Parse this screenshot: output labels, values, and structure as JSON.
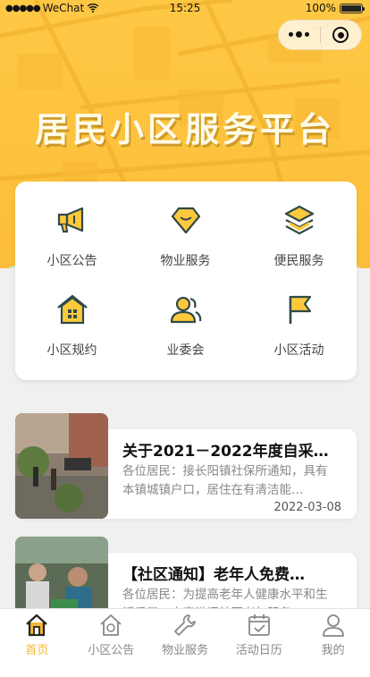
{
  "status": {
    "carrier": "WeChat",
    "time": "15:25",
    "battery": "100%"
  },
  "capsule": {
    "more_icon": "more-dots-icon",
    "close_icon": "close-miniapp-icon"
  },
  "hero": {
    "title": "居民小区服务平台"
  },
  "services": [
    {
      "label": "小区公告",
      "icon": "megaphone-icon"
    },
    {
      "label": "物业服务",
      "icon": "diamond-icon"
    },
    {
      "label": "便民服务",
      "icon": "layers-icon"
    },
    {
      "label": "小区规约",
      "icon": "house-icon"
    },
    {
      "label": "业委会",
      "icon": "users-icon"
    },
    {
      "label": "小区活动",
      "icon": "flag-icon"
    }
  ],
  "news": [
    {
      "title": "关于2021－2022年度自采…",
      "desc": "各位居民：接长阳镇社保所通知，具有本镇城镇户口，居住在有清洁能…",
      "date": "2022-03-08"
    },
    {
      "title": "【社区通知】老年人免费…",
      "desc": "各位居民：为提高老年人健康水平和生活质量，丰富微门社区老年服务",
      "date": ""
    }
  ],
  "tabs": [
    {
      "label": "首页",
      "icon": "home-icon",
      "active": true
    },
    {
      "label": "小区公告",
      "icon": "announcement-icon",
      "active": false
    },
    {
      "label": "物业服务",
      "icon": "wrench-icon",
      "active": false
    },
    {
      "label": "活动日历",
      "icon": "calendar-icon",
      "active": false
    },
    {
      "label": "我的",
      "icon": "profile-icon",
      "active": false
    }
  ],
  "colors": {
    "accent": "#f5b733",
    "icon_yellow": "#fcc93d",
    "icon_dark": "#2f4a48",
    "hero": "#fdc23e",
    "arc": "#c9f0ea"
  }
}
